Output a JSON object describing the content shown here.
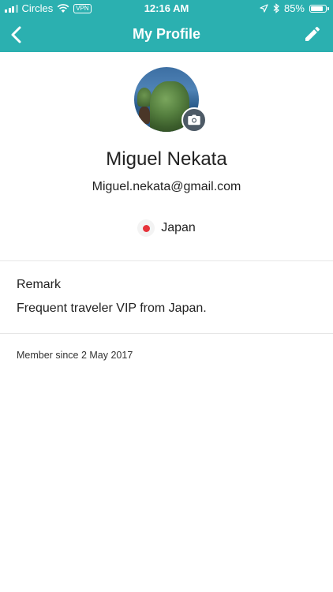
{
  "status_bar": {
    "carrier": "Circles",
    "vpn": "VPN",
    "time": "12:16 AM",
    "battery": "85%",
    "battery_level": 0.85
  },
  "nav": {
    "title": "My Profile",
    "back_icon": "chevron-left-icon",
    "edit_icon": "pencil-icon"
  },
  "profile": {
    "name": "Miguel Nekata",
    "email": "Miguel.nekata@gmail.com",
    "country": "Japan",
    "flag_color": "#e6333a"
  },
  "remark": {
    "label": "Remark",
    "value": "Frequent traveler VIP from Japan."
  },
  "member_since": "Member since 2 May 2017",
  "colors": {
    "accent": "#2bb0b0"
  }
}
